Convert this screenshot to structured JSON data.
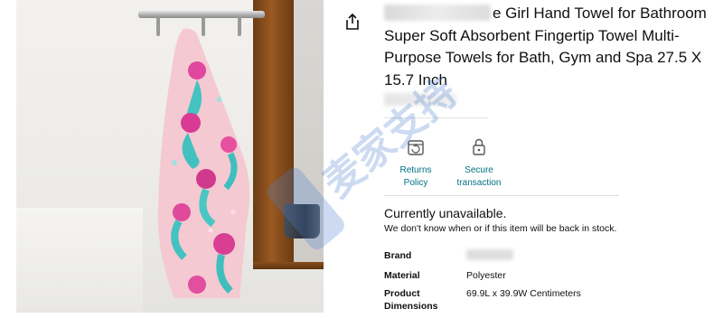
{
  "product": {
    "title_visible": "e Girl Hand Towel for Bathroom Super Soft Absorbent Fingertip Towel Multi-Purpose Towels for Bath, Gym and Spa 27.5 X 15.7 Inch"
  },
  "icons": {
    "share": "share-icon",
    "returns": "returns-box-icon",
    "secure": "lock-icon"
  },
  "features": [
    {
      "label": "Returns Policy"
    },
    {
      "label": "Secure transaction"
    }
  ],
  "availability": {
    "status": "Currently unavailable.",
    "note": "We don't know when or if this item will be back in stock."
  },
  "specs": {
    "brand_label": "Brand",
    "material_label": "Material",
    "material_value": "Polyester",
    "dimensions_label": "Product Dimensions",
    "dimensions_value": "69.9L x 39.9W Centimeters"
  },
  "watermark": {
    "text": "麦家支持"
  },
  "colors": {
    "link": "#007185",
    "text": "#0f1111",
    "watermark": "#4a7fd0"
  }
}
